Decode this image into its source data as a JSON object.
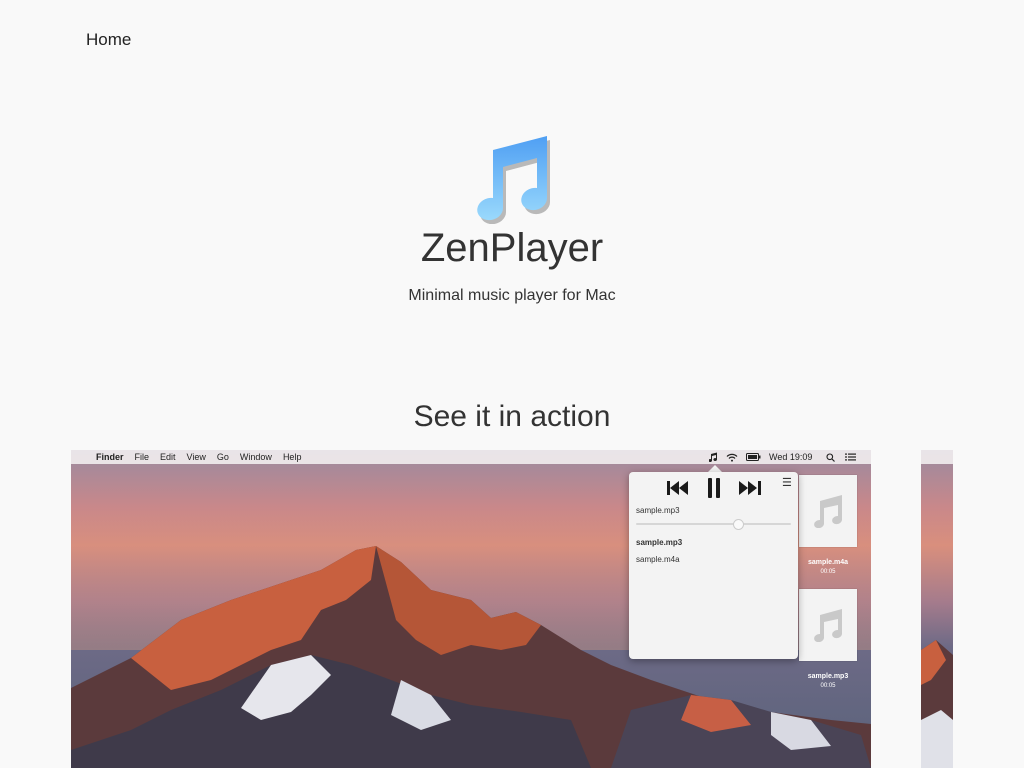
{
  "nav": {
    "home_label": "Home"
  },
  "hero": {
    "icon": "music-note-icon",
    "title": "ZenPlayer",
    "tagline": "Minimal music player for Mac"
  },
  "section": {
    "heading": "See it in action"
  },
  "colors": {
    "icon_top": "#5aa8f5",
    "icon_bottom": "#8fd2fb",
    "background": "#f9f9f9"
  },
  "screenshot": {
    "menubar": {
      "apple": "",
      "items": [
        "Finder",
        "File",
        "Edit",
        "View",
        "Go",
        "Window",
        "Help"
      ],
      "clock": "Wed 19:09",
      "status_icons": [
        "music-note-icon",
        "wifi-icon",
        "battery-icon",
        "search-icon",
        "list-icon"
      ]
    },
    "player": {
      "now_playing": "sample.mp3",
      "progress": 0.66,
      "menu_icon": "☰",
      "playlist": [
        {
          "name": "sample.mp3",
          "active": true
        },
        {
          "name": "sample.m4a",
          "active": false
        }
      ]
    },
    "desktop_files": [
      {
        "name": "sample.m4a",
        "duration": "00:05"
      },
      {
        "name": "sample.mp3",
        "duration": "00:05"
      }
    ]
  },
  "next_slide": {
    "apple": ""
  }
}
